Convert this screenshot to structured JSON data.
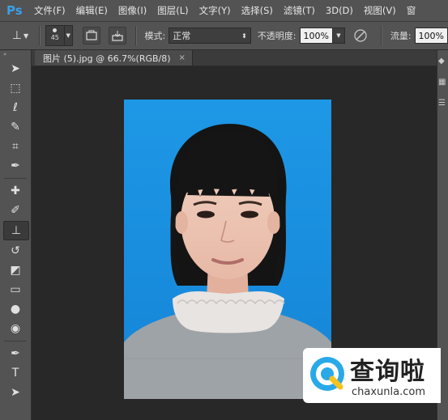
{
  "app": {
    "logo": "Ps"
  },
  "menu": [
    "文件(F)",
    "编辑(E)",
    "图像(I)",
    "图层(L)",
    "文字(Y)",
    "选择(S)",
    "滤镜(T)",
    "3D(D)",
    "视图(V)",
    "窗"
  ],
  "options": {
    "brush_size": "45",
    "mode_label": "模式:",
    "mode_value": "正常",
    "opacity_label": "不透明度:",
    "opacity_value": "100%",
    "flow_label": "流量:",
    "flow_value": "100%"
  },
  "tools": [
    {
      "name": "move-tool",
      "icon": "move-icon",
      "glyph": "➤"
    },
    {
      "name": "marquee-tool",
      "icon": "marquee-icon",
      "glyph": "⬚"
    },
    {
      "name": "lasso-tool",
      "icon": "lasso-icon",
      "glyph": "ℓ"
    },
    {
      "name": "quick-selection-tool",
      "icon": "quick-selection-icon",
      "glyph": "✎"
    },
    {
      "name": "crop-tool",
      "icon": "crop-icon",
      "glyph": "⌗"
    },
    {
      "name": "eyedropper-tool",
      "icon": "eyedropper-icon",
      "glyph": "✒"
    },
    {
      "name": "healing-brush-tool",
      "icon": "healing-icon",
      "glyph": "✚"
    },
    {
      "name": "brush-tool",
      "icon": "brush-icon",
      "glyph": "✐"
    },
    {
      "name": "clone-stamp-tool",
      "icon": "stamp-icon",
      "glyph": "⊥",
      "active": true
    },
    {
      "name": "history-brush-tool",
      "icon": "history-brush-icon",
      "glyph": "↺"
    },
    {
      "name": "eraser-tool",
      "icon": "eraser-icon",
      "glyph": "◩"
    },
    {
      "name": "gradient-tool",
      "icon": "gradient-icon",
      "glyph": "▭"
    },
    {
      "name": "blur-tool",
      "icon": "blur-icon",
      "glyph": "●"
    },
    {
      "name": "dodge-tool",
      "icon": "dodge-icon",
      "glyph": "◉"
    },
    {
      "name": "pen-tool",
      "icon": "pen-icon",
      "glyph": "✒"
    },
    {
      "name": "type-tool",
      "icon": "type-icon",
      "glyph": "T"
    },
    {
      "name": "path-selection-tool",
      "icon": "path-selection-icon",
      "glyph": "➤"
    }
  ],
  "document": {
    "tab_title": "图片 (5).jpg @ 66.7%(RGB/8)",
    "close": "×"
  },
  "colors": {
    "accent": "#3aa0e8",
    "photo_bg": "#1a8fe0",
    "ui_gray": "#535353",
    "canvas": "#282828"
  },
  "watermark": {
    "title": "查询啦",
    "subtitle": "chaxunla.com"
  }
}
